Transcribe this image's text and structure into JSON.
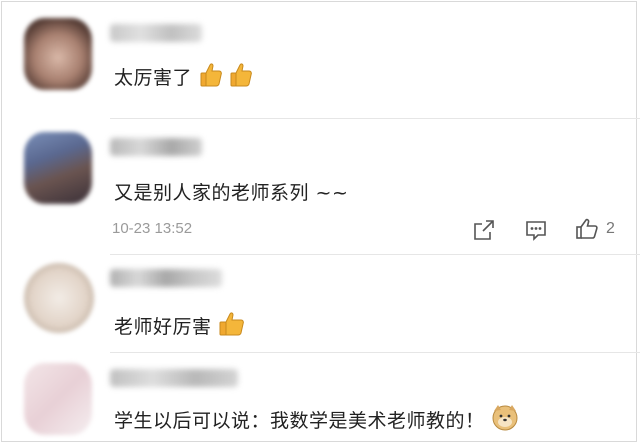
{
  "comments": [
    {
      "username": "",
      "text": "太厉害了",
      "emoji": [
        "thumbs-up-icon",
        "thumbs-up-icon"
      ]
    },
    {
      "username": "",
      "text": "又是别人家的老师系列 ~~",
      "time": "10-23 13:52",
      "actions": {
        "share_icon": "share-icon",
        "reply_icon": "reply-icon",
        "like_icon": "thumbs-up-outline-icon",
        "like_count": "2"
      }
    },
    {
      "username": "",
      "text": "老师好厉害",
      "emoji": [
        "thumbs-up-icon"
      ]
    },
    {
      "username": "",
      "text": "学生以后可以说：我数学是美术老师教的！",
      "emoji": [
        "doge-face-icon"
      ]
    }
  ],
  "colors": {
    "text": "#222222",
    "meta": "#9a9a9a",
    "divider": "#e6e6e6",
    "emoji_yellow": "#f4b63a"
  }
}
